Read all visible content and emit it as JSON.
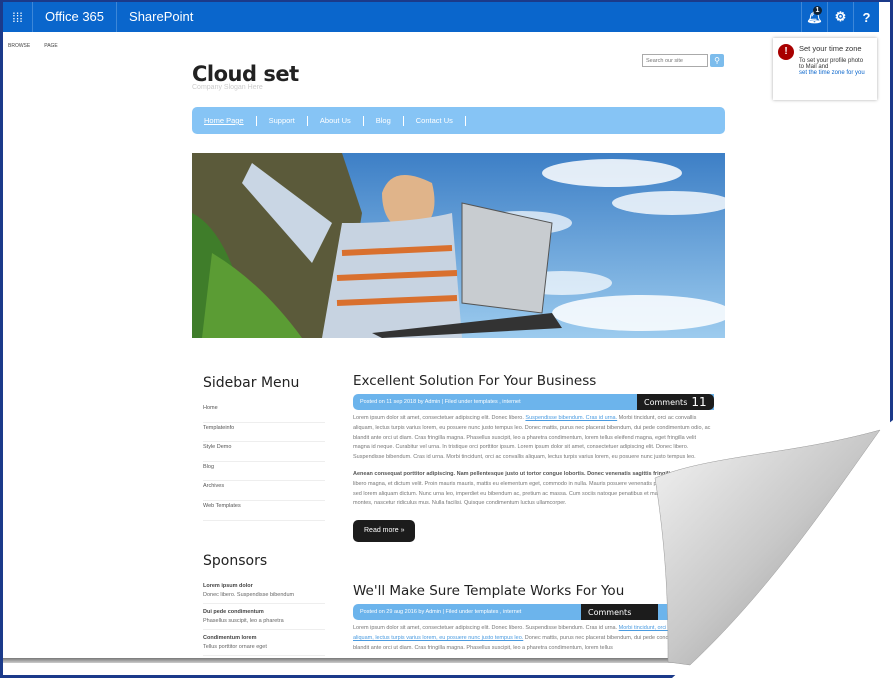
{
  "topbar": {
    "app_launcher_icon": "waffle-icon",
    "brand": "Office 365",
    "product": "SharePoint",
    "notification_count": "1",
    "icons": [
      "bell-icon",
      "gear-icon",
      "help-icon"
    ],
    "help_label": "?"
  },
  "ribbon": {
    "tabs": [
      "BROWSE",
      "PAGE"
    ]
  },
  "toast": {
    "title": "Set your time zone",
    "line1": "To set your profile photo",
    "line2": "to Mail and",
    "link": "set the time zone for you"
  },
  "search": {
    "placeholder": "Search our site"
  },
  "site": {
    "title": "Cloud set",
    "slogan": "Company Slogan Here"
  },
  "nav": {
    "items": [
      "Home Page",
      "Support",
      "About Us",
      "Blog",
      "Contact Us"
    ]
  },
  "sidebar": {
    "title": "Sidebar  Menu",
    "items": [
      "Home",
      "Templateinfo",
      "Style Demo",
      "Blog",
      "Archives",
      "Web Templates"
    ]
  },
  "sponsors": {
    "title": "Sponsors",
    "items": [
      {
        "title": "Lorem ipsum dolor",
        "text": "Donec libero. Suspendisse bibendum"
      },
      {
        "title": "Dui pede condimentum",
        "text": "Phasellus suscipit, leo a pharetra"
      },
      {
        "title": "Condimentum lorem",
        "text": "Tellus porttitor ornare eget"
      }
    ]
  },
  "posts": [
    {
      "title": "Excellent Solution  For Your Business",
      "meta": "Posted on 11 sep 2018 by  Admin   |   Filed under  templates  ,  internet",
      "comments_label": "Comments",
      "comments_count": "11",
      "p1_start": "Lorem ipsum dolor sit amet, consectetuer adipiscing elit. Donec libero. ",
      "p1_link": "Suspendisse bibendum. Cras id urna.",
      "p1_end": " Morbi tincidunt, orci ac convallis aliquam, lectus turpis varius lorem, eu posuere nunc justo tempus leo. Donec mattis, purus nec placerat bibendum, dui pede condimentum odio, ac blandit ante orci ut diam. Cras fringilla magna. Phasellus suscipit, leo a pharetra condimentum, lorem tellus eleifend magna, eget fringilla velit magna id neque. Curabitur vel urna. In tristique orci porttitor ipsum. Lorem ipsum dolor sit amet, consectetuer adipiscing elit. Donec libero. Suspendisse bibendum. Cras id urna. Morbi tincidunt, orci ac convallis aliquam, lectus turpis varius lorem, eu posuere nunc justo tempus leo.",
      "p2_bold": "Aenean consequat porttitor adipiscing. Nam pellentesque justo ut tortor congue lobortis. Donec venenatis sagittis fringilla.",
      "p2": " Etiam nec libero magna, et dictum velit. Proin mauris mauris, mattis eu elementum eget, commodo in nulla. Mauris posuere venenatis pretium. Maecenas a dui sed lorem aliquam dictum. Nunc urna leo, imperdiet eu bibendum ac, pretium ac massa. Cum sociis natoque penatibus et magnis dis parturient montes, nascetur ridiculus mus. Nulla facilisi. Quisque condimentum luctus ullamcorper.",
      "read_more": "Read more »"
    },
    {
      "title": "We'll Make Sure Template  Works For You",
      "meta": "Posted on 29 aug 2016 by  Admin   |   Filed under  templates  ,  internet",
      "comments_label": "Comments",
      "p1_start": "Lorem ipsum dolor sit amet, consectetuer adipiscing elit. Donec libero. Suspendisse bibendum. Cras id urna. ",
      "p1_link": "Morbi tincidunt, orci ac convallis aliquam, lectus turpis varius lorem, eu posuere nunc justo tempus leo.",
      "p1_end": " Donec mattis, purus nec placerat bibendum, dui pede condimentum odio, ac blandit ante orci ut diam. Cras fringilla magna. Phasellus suscipit, leo a pharetra condimentum, lorem tellus"
    }
  ],
  "colors": {
    "topbar": "#0a66cc",
    "nav": "#86c4f5",
    "meta_bar": "#6cb4ec",
    "dark": "#1c1c1c"
  }
}
